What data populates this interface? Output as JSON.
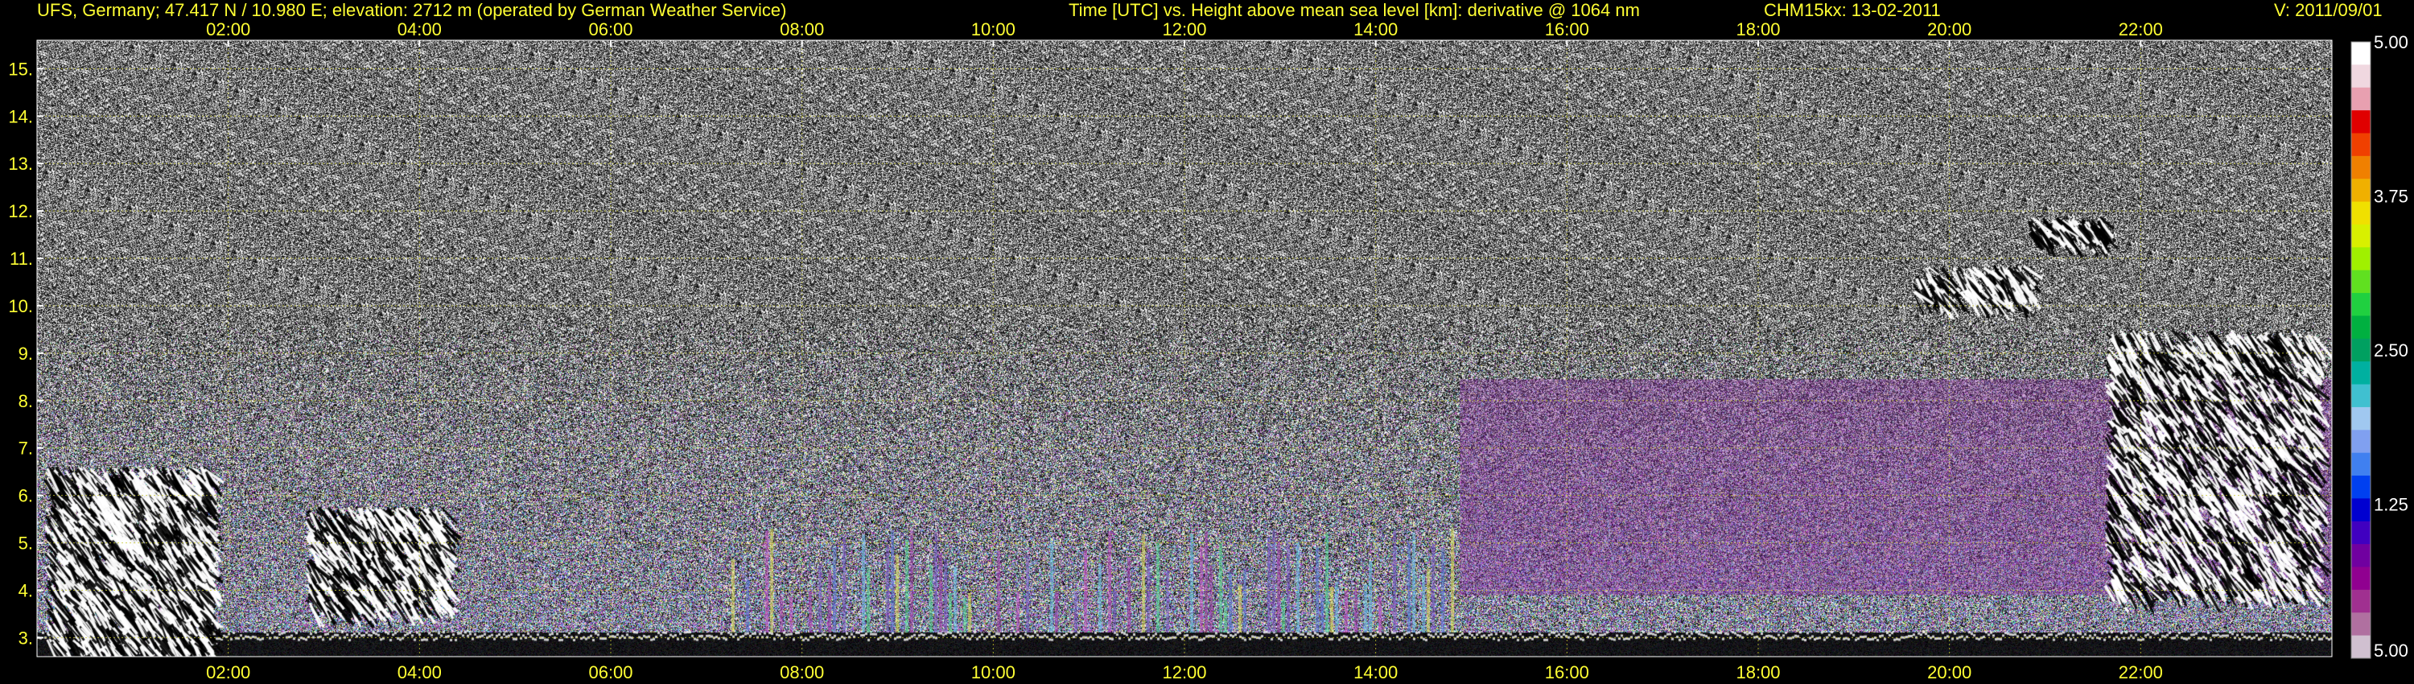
{
  "header": {
    "site": "UFS, Germany; 47.417 N / 10.980 E; elevation: 2712 m  (operated by German Weather Service)",
    "description": "Time [UTC] vs. Height above mean sea level [km]: derivative @ 1064 nm",
    "instrument": "CHM15kx: 13-02-2011",
    "version": "V: 2011/09/01"
  },
  "colors": {
    "text": "#ffff33",
    "grid": "#c8c832",
    "background": "#000000"
  },
  "chart_data": {
    "type": "heatmap",
    "x_tick_labels": [
      "02:00",
      "04:00",
      "06:00",
      "08:00",
      "10:00",
      "12:00",
      "14:00",
      "16:00",
      "18:00",
      "20:00",
      "22:00"
    ],
    "x_tick_hours": [
      2,
      4,
      6,
      8,
      10,
      12,
      14,
      16,
      18,
      20,
      22
    ],
    "xlim": [
      0,
      24
    ],
    "y_tick_labels": [
      "3.",
      "4.",
      "5.",
      "6.",
      "7.",
      "8.",
      "9.",
      "10.",
      "11.",
      "12.",
      "13.",
      "14.",
      "15."
    ],
    "y_tick_values": [
      3,
      4,
      5,
      6,
      7,
      8,
      9,
      10,
      11,
      12,
      13,
      14,
      15
    ],
    "ylim": [
      2.6,
      15.6
    ],
    "grid": true,
    "colorbar": {
      "tick_labels": [
        "5.00",
        "3.75",
        "2.50",
        "1.25",
        "5.00"
      ],
      "tick_fractions": [
        0,
        0.25,
        0.5,
        0.75,
        1.0
      ],
      "colors": [
        "#ffffff",
        "#f0d8e0",
        "#e8a0b0",
        "#e00000",
        "#f04000",
        "#f08000",
        "#f0b000",
        "#f0e000",
        "#d8f000",
        "#a0f000",
        "#60e020",
        "#20d040",
        "#00b040",
        "#00a060",
        "#00b0a0",
        "#40c0d0",
        "#a0c8f0",
        "#80a0f0",
        "#4080f0",
        "#0040f0",
        "#0000d0",
        "#4000c0",
        "#7000a0",
        "#900090",
        "#a03090",
        "#b070a0",
        "#d0c0d0"
      ]
    }
  }
}
